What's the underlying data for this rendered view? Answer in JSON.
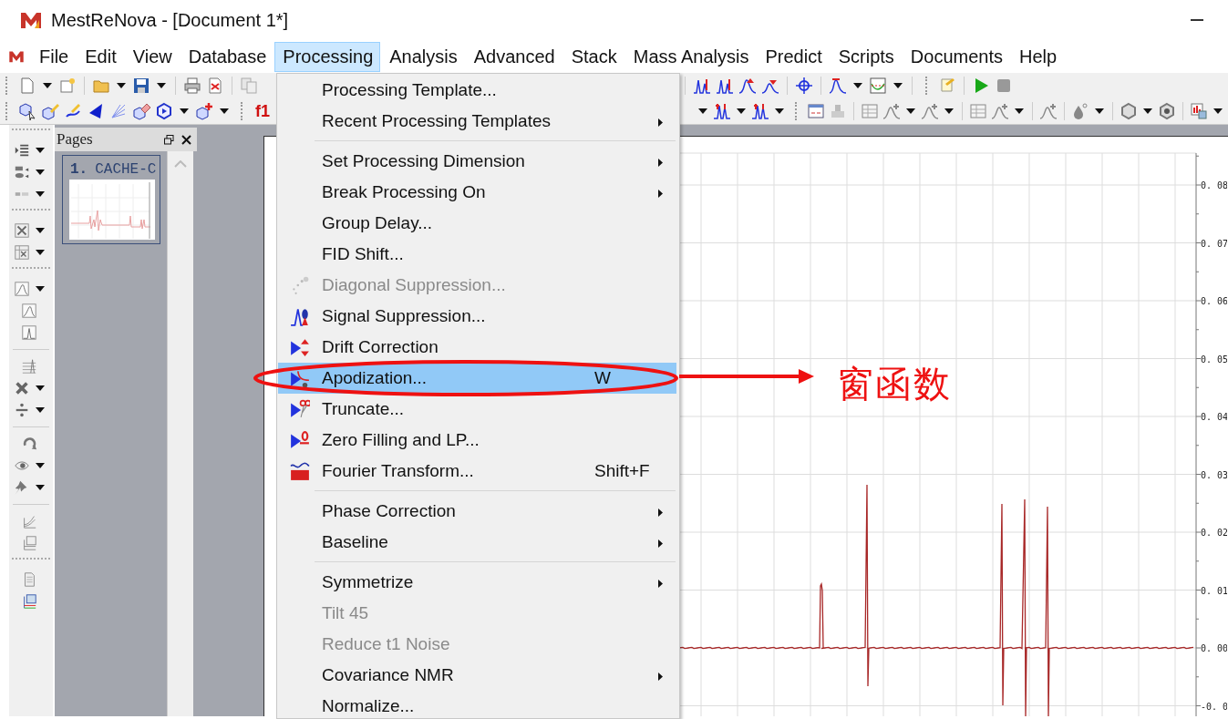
{
  "window": {
    "title": "MestReNova - [Document 1*]"
  },
  "menu_bar": [
    {
      "label": "File",
      "selected": false
    },
    {
      "label": "Edit",
      "selected": false
    },
    {
      "label": "View",
      "selected": false
    },
    {
      "label": "Database",
      "selected": false
    },
    {
      "label": "Processing",
      "selected": true
    },
    {
      "label": "Analysis",
      "selected": false
    },
    {
      "label": "Advanced",
      "selected": false
    },
    {
      "label": "Stack",
      "selected": false
    },
    {
      "label": "Mass Analysis",
      "selected": false
    },
    {
      "label": "Predict",
      "selected": false
    },
    {
      "label": "Scripts",
      "selected": false
    },
    {
      "label": "Documents",
      "selected": false
    },
    {
      "label": "Help",
      "selected": false
    }
  ],
  "toolbar": {
    "buttons": [
      {
        "label": "f1"
      }
    ]
  },
  "pages_panel": {
    "title": "Pages",
    "pages": [
      {
        "number": "1.",
        "name": "CACHE-C"
      }
    ]
  },
  "spectrum": {
    "y_axis_labels": [
      "0. 08",
      "0. 07",
      "0. 06",
      "0. 05",
      "0. 04",
      "0. 03",
      "0. 02",
      "0. 01",
      "0. 00",
      "-0. 0"
    ]
  },
  "processing_menu": {
    "items": [
      {
        "kind": "item",
        "label": "Processing Template...",
        "submenu": false,
        "disabled": false,
        "selected": false
      },
      {
        "kind": "item",
        "label": "Recent Processing Templates",
        "submenu": true,
        "disabled": false,
        "selected": false
      },
      {
        "kind": "separator"
      },
      {
        "kind": "item",
        "label": "Set Processing Dimension",
        "submenu": true,
        "disabled": false,
        "selected": false
      },
      {
        "kind": "item",
        "label": "Break Processing On",
        "submenu": true,
        "disabled": false,
        "selected": false
      },
      {
        "kind": "item",
        "label": "Group Delay...",
        "submenu": false,
        "disabled": false,
        "selected": false
      },
      {
        "kind": "item",
        "label": "FID Shift...",
        "submenu": false,
        "disabled": false,
        "selected": false
      },
      {
        "kind": "item",
        "label": "Diagonal Suppression...",
        "submenu": false,
        "disabled": true,
        "selected": false
      },
      {
        "kind": "item",
        "label": "Signal Suppression...",
        "submenu": false,
        "disabled": false,
        "selected": false
      },
      {
        "kind": "item",
        "label": "Drift Correction",
        "submenu": false,
        "disabled": false,
        "selected": false
      },
      {
        "kind": "item",
        "label": "Apodization...",
        "shortcut": "W",
        "submenu": false,
        "disabled": false,
        "selected": true
      },
      {
        "kind": "item",
        "label": "Truncate...",
        "submenu": false,
        "disabled": false,
        "selected": false
      },
      {
        "kind": "item",
        "label": "Zero Filling and LP...",
        "submenu": false,
        "disabled": false,
        "selected": false
      },
      {
        "kind": "item",
        "label": "Fourier Transform...",
        "shortcut": "Shift+F",
        "submenu": false,
        "disabled": false,
        "selected": false
      },
      {
        "kind": "separator"
      },
      {
        "kind": "item",
        "label": "Phase Correction",
        "submenu": true,
        "disabled": false,
        "selected": false
      },
      {
        "kind": "item",
        "label": "Baseline",
        "submenu": true,
        "disabled": false,
        "selected": false
      },
      {
        "kind": "separator"
      },
      {
        "kind": "item",
        "label": "Symmetrize",
        "submenu": true,
        "disabled": false,
        "selected": false
      },
      {
        "kind": "item",
        "label": "Tilt 45",
        "submenu": false,
        "disabled": true,
        "selected": false
      },
      {
        "kind": "item",
        "label": "Reduce t1 Noise",
        "submenu": false,
        "disabled": true,
        "selected": false
      },
      {
        "kind": "item",
        "label": "Covariance NMR",
        "submenu": true,
        "disabled": false,
        "selected": false
      },
      {
        "kind": "item",
        "label": "Normalize...",
        "submenu": false,
        "disabled": false,
        "selected": false
      }
    ]
  },
  "annotation": {
    "text": "窗函数"
  }
}
